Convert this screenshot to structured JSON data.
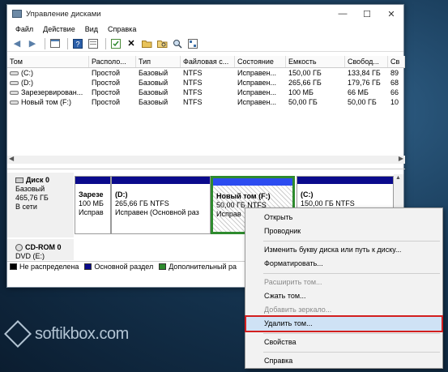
{
  "window": {
    "title": "Управление дисками",
    "minimize": "—",
    "maximize": "☐",
    "close": "✕"
  },
  "menu": [
    "Файл",
    "Действие",
    "Вид",
    "Справка"
  ],
  "toolbar_icons": [
    "back-icon",
    "forward-icon",
    "view-icon",
    "help-icon",
    "help-book-icon",
    "properties-icon",
    "delete-icon",
    "open-icon",
    "explore-icon",
    "rescan-icon"
  ],
  "volume_table": {
    "headers": [
      "Том",
      "Располо...",
      "Тип",
      "Файловая с...",
      "Состояние",
      "Емкость",
      "Свобод...",
      "Св"
    ],
    "rows": [
      [
        "(C:)",
        "Простой",
        "Базовый",
        "NTFS",
        "Исправен...",
        "150,00 ГБ",
        "133,84 ГБ",
        "89"
      ],
      [
        "(D:)",
        "Простой",
        "Базовый",
        "NTFS",
        "Исправен...",
        "265,66 ГБ",
        "179,76 ГБ",
        "68"
      ],
      [
        "Зарезервирован...",
        "Простой",
        "Базовый",
        "NTFS",
        "Исправен...",
        "100 МБ",
        "66 МБ",
        "66"
      ],
      [
        "Новый том (F:)",
        "Простой",
        "Базовый",
        "NTFS",
        "Исправен...",
        "50,00 ГБ",
        "50,00 ГБ",
        "10"
      ]
    ]
  },
  "disks": {
    "disk0": {
      "name": "Диск 0",
      "type": "Базовый",
      "size": "465,76 ГБ",
      "status": "В сети",
      "partitions": [
        {
          "line1": "Зарезе",
          "line2": "100 МБ",
          "line3": "Исправ"
        },
        {
          "line1": "(D:)",
          "line2": "265,66 ГБ NTFS",
          "line3": "Исправен (Основной раз"
        },
        {
          "line1": "Новый том  (F:)",
          "line2": "50,00 ГБ NTFS",
          "line3": "Исправ"
        },
        {
          "line1": "(C:)",
          "line2": "150,00 ГБ NTFS",
          "line3": ""
        }
      ]
    },
    "cdrom": {
      "name": "CD-ROM 0",
      "drive": "DVD (E:)"
    }
  },
  "legend": [
    {
      "label": "Не распределена",
      "color": "#000000"
    },
    {
      "label": "Основной раздел",
      "color": "#0a0a8c"
    },
    {
      "label": "Дополнительный ра",
      "color": "#2e8b2e"
    }
  ],
  "context_menu": {
    "items": [
      {
        "label": "Открыть",
        "disabled": false
      },
      {
        "label": "Проводник",
        "disabled": false
      },
      {
        "label": "Изменить букву диска или путь к диску...",
        "disabled": false
      },
      {
        "label": "Форматировать...",
        "disabled": false
      },
      {
        "label": "Расширить том...",
        "disabled": true
      },
      {
        "label": "Сжать том...",
        "disabled": false
      },
      {
        "label": "Добавить зеркало...",
        "disabled": true
      },
      {
        "label": "Удалить том...",
        "disabled": false,
        "highlighted": true
      },
      {
        "label": "Свойства",
        "disabled": false
      },
      {
        "label": "Справка",
        "disabled": false
      }
    ]
  },
  "watermark": "softikbox.com"
}
